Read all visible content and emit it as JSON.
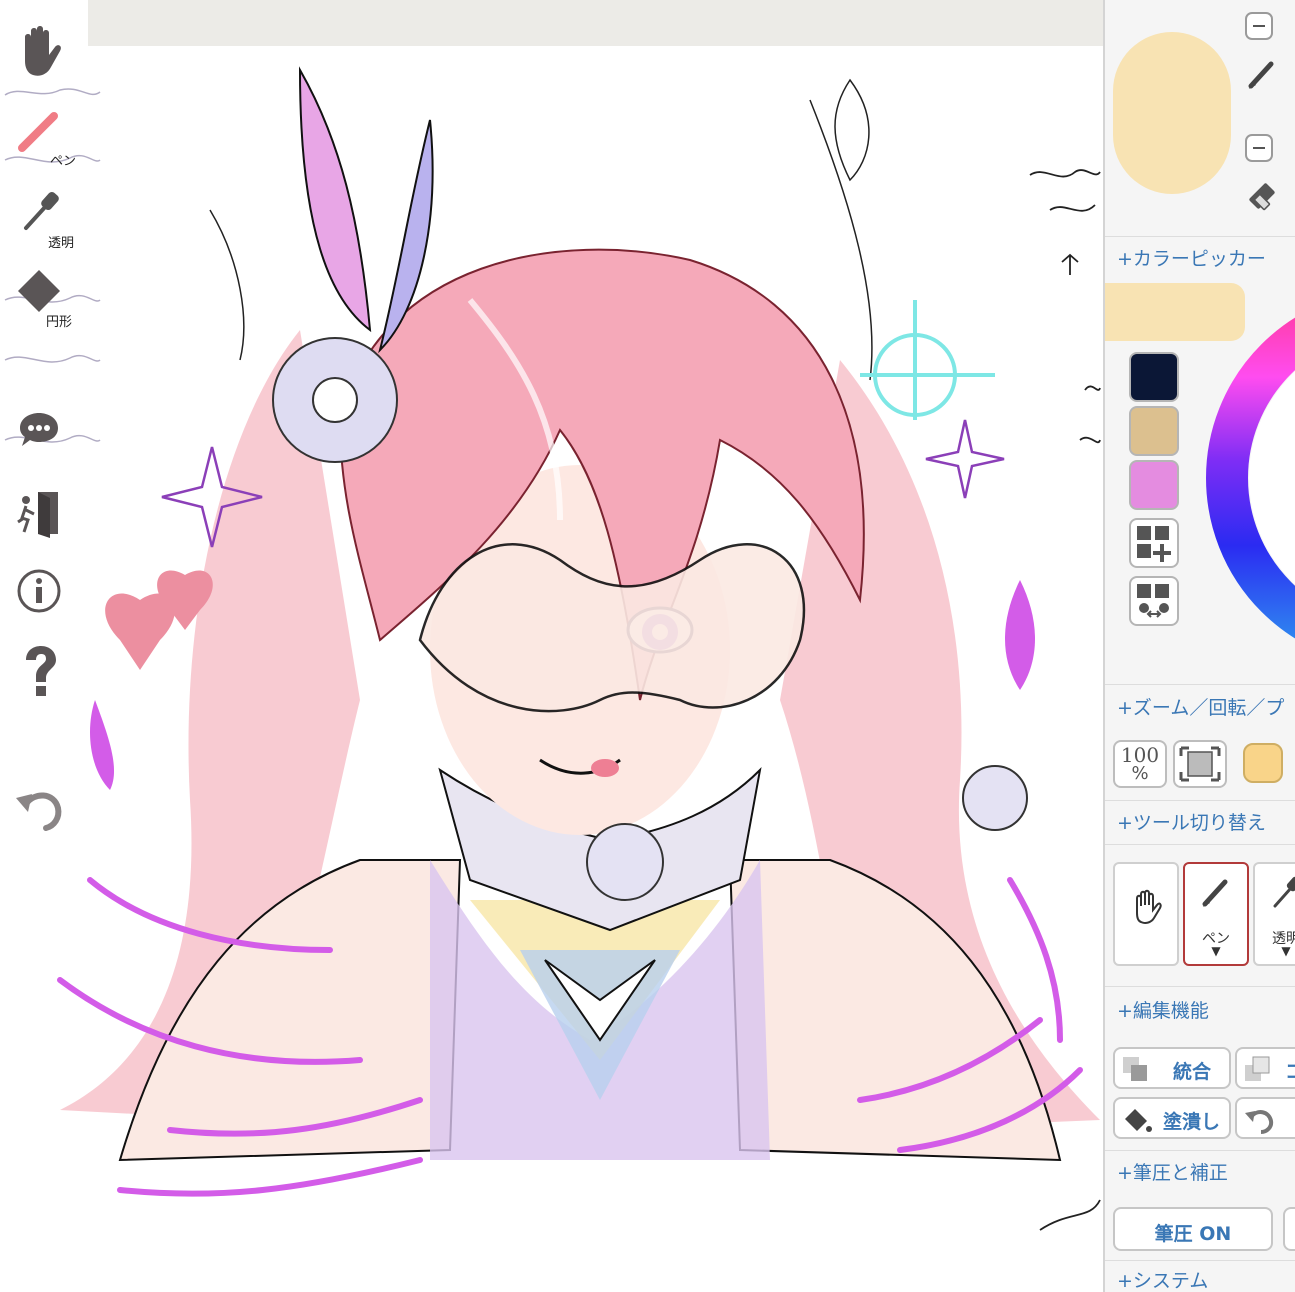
{
  "left_toolbar": {
    "pen_label": "ペン",
    "transparent_label": "透明",
    "circle_label": "円形"
  },
  "right_panel": {
    "current_color": "#f8e3b3",
    "layers": [
      {
        "tool_icon": "pencil-icon"
      },
      {
        "tool_icon": "eraser-icon"
      }
    ],
    "color_picker": {
      "header": "+カラーピッカー",
      "palette": [
        {
          "color": "#0b1736"
        },
        {
          "color": "#dcc08f"
        },
        {
          "color": "#e48ce0"
        }
      ],
      "add_swatch_icon": "grid-plus-icon",
      "swap_swatch_icon": "grid-swap-icon"
    },
    "zoom": {
      "header": "+ズーム／回転／プ",
      "zoom_100_top": "100",
      "zoom_100_bottom": "%",
      "fit_icon": "fit-screen-icon",
      "color_chip": "#f9d489"
    },
    "tool_switch": {
      "header": "+ツール切り替え",
      "tools": [
        {
          "icon": "hand-icon",
          "label": ""
        },
        {
          "icon": "pen-icon",
          "label": "ペン",
          "arrow": "▼"
        },
        {
          "icon": "eyedropper-icon",
          "label": "透明",
          "arrow": "▼"
        }
      ]
    },
    "edit": {
      "header": "+編集機能",
      "merge_label": "統合",
      "copy_label": "コ",
      "fill_label": "塗潰し"
    },
    "pressure": {
      "header": "+筆圧と補正",
      "pressure_label": "筆圧 ON"
    },
    "system": {
      "header": "+システム"
    }
  }
}
